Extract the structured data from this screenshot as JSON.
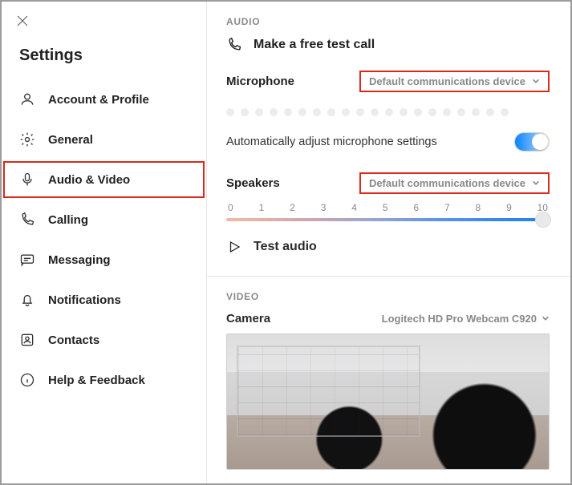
{
  "header": {
    "title": "Settings"
  },
  "sidebar": {
    "items": [
      {
        "label": "Account & Profile"
      },
      {
        "label": "General"
      },
      {
        "label": "Audio & Video"
      },
      {
        "label": "Calling"
      },
      {
        "label": "Messaging"
      },
      {
        "label": "Notifications"
      },
      {
        "label": "Contacts"
      },
      {
        "label": "Help & Feedback"
      }
    ]
  },
  "audio": {
    "section": "AUDIO",
    "test_call": "Make a free test call",
    "microphone_label": "Microphone",
    "microphone_device": "Default communications device",
    "auto_adjust": "Automatically adjust microphone settings",
    "auto_adjust_on": true,
    "speakers_label": "Speakers",
    "speakers_device": "Default communications device",
    "volume_ticks": [
      "0",
      "1",
      "2",
      "3",
      "4",
      "5",
      "6",
      "7",
      "8",
      "9",
      "10"
    ],
    "test_audio": "Test audio"
  },
  "video": {
    "section": "VIDEO",
    "camera_label": "Camera",
    "camera_device": "Logitech HD Pro Webcam C920"
  }
}
